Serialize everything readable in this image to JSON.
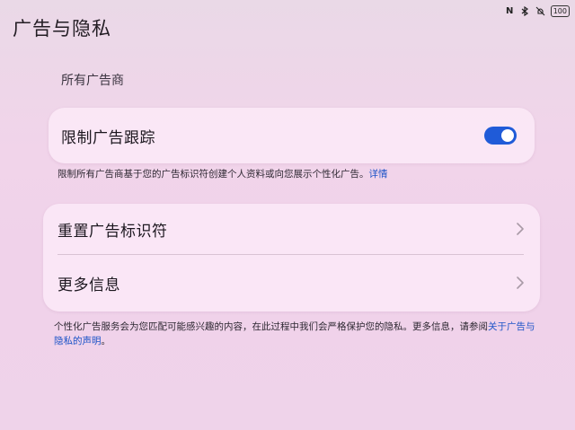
{
  "title": "广告与隐私",
  "status_bar": {
    "icons": [
      "nfc-icon",
      "bluetooth-icon",
      "mute-icon"
    ],
    "nfc_glyph": "N",
    "battery": "100"
  },
  "section_label": "所有广告商",
  "limit_tracking": {
    "label": "限制广告跟踪",
    "enabled": true,
    "toggle_color": "#1f5bd8"
  },
  "limit_tracking_desc": {
    "text": "限制所有广告商基于您的广告标识符创建个人资料或向您展示个性化广告。",
    "link": "详情"
  },
  "menu": {
    "reset": "重置广告标识符",
    "more_info": "更多信息"
  },
  "footer": {
    "text": "个性化广告服务会为您匹配可能感兴趣的内容，在此过程中我们会严格保护您的隐私。更多信息，请参阅",
    "link": "关于广告与隐私的声明",
    "suffix": "。"
  },
  "accent_color": "#1e54c8"
}
